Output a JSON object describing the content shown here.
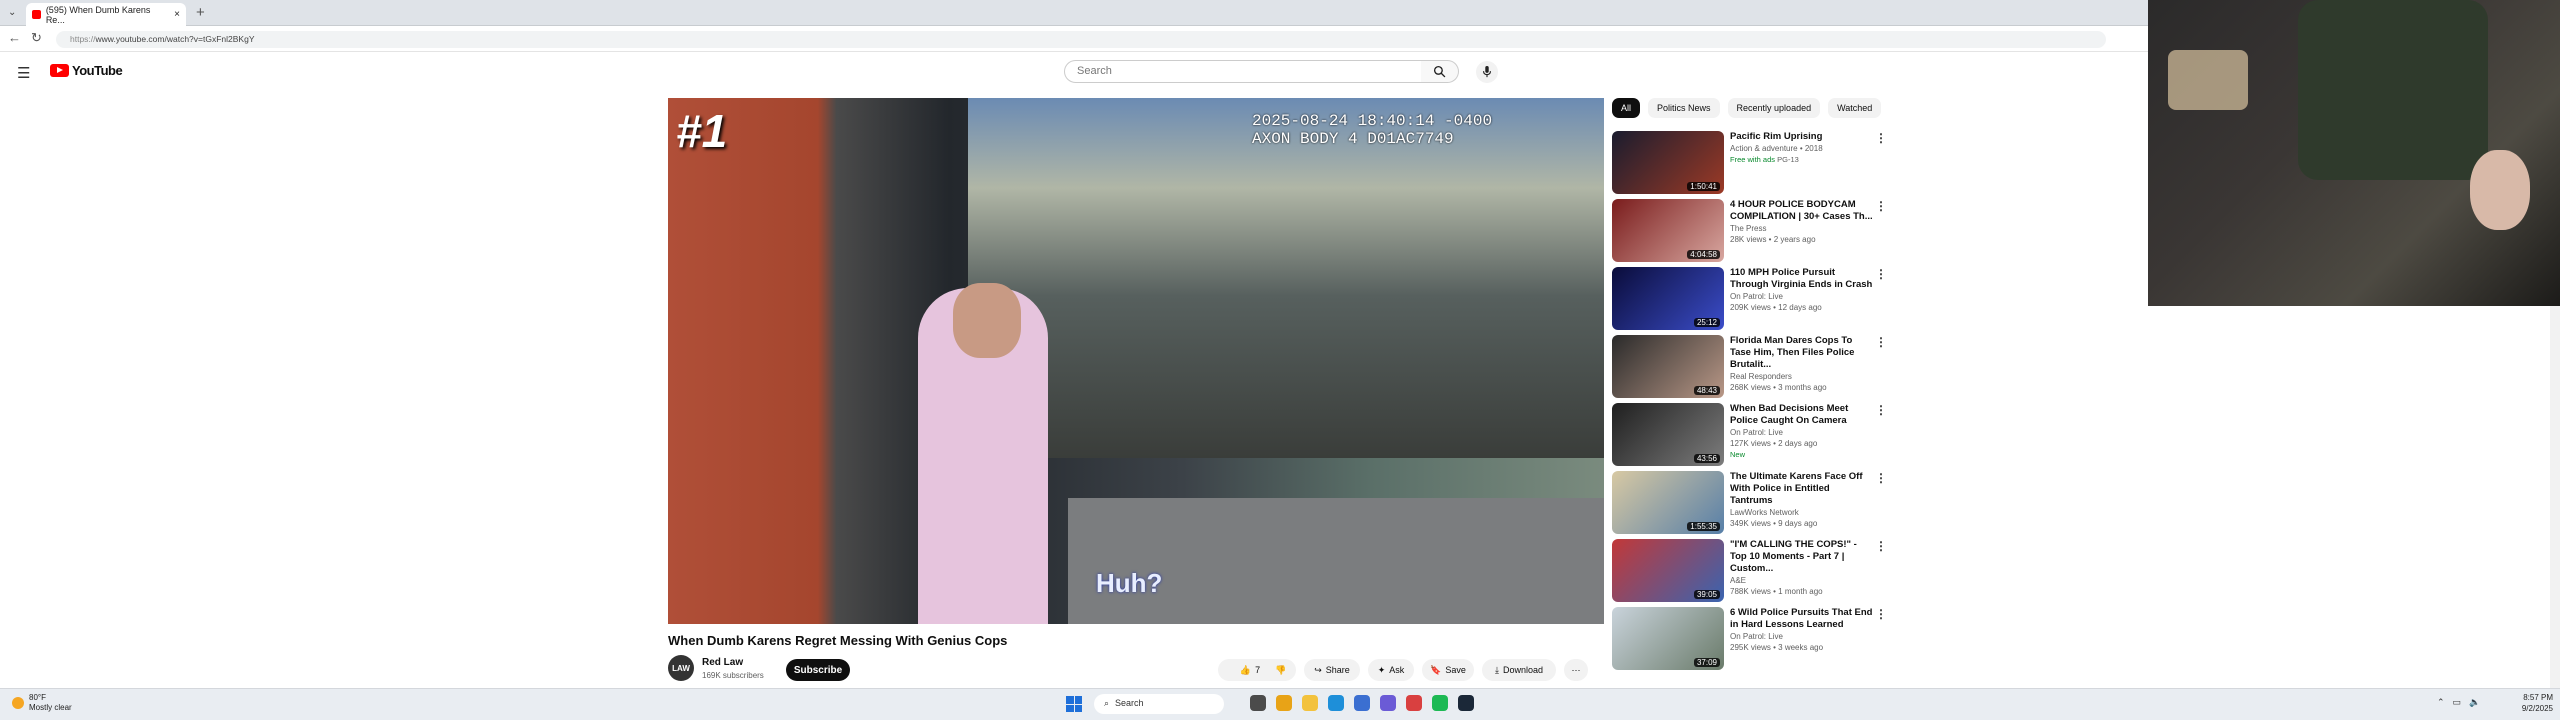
{
  "browser": {
    "tab_title": "(595) When Dumb Karens Re...",
    "url_prefix": "https://",
    "url_rest": "www.youtube.com/watch?v=tGxFnl2BKgY",
    "nav_back": "←",
    "nav_forward": "→",
    "nav_reload": "↻",
    "new_tab": "+",
    "close_tab": "×",
    "tab_menu": "⌄"
  },
  "header": {
    "menu_icon": "☰",
    "logo_text": "YouTube",
    "search_placeholder": "Search"
  },
  "video": {
    "title": "When Dumb Karens Regret Messing With Genius Cops",
    "overlay_rank": "#1",
    "overlay_timestamp_line1": "2025-08-24 18:40:14 -0400",
    "overlay_timestamp_line2": "AXON BODY 4 D01AC7749",
    "overlay_caption": "Huh?",
    "channel_name": "Red Law",
    "channel_avatar_text": "LAW",
    "channel_subs": "169K subscribers",
    "subscribe": "Subscribe",
    "actions": {
      "like_count": "7",
      "share": "Share",
      "ask": "Ask",
      "save": "Save",
      "download": "Download",
      "more": "⋯"
    }
  },
  "chips": [
    "All",
    "Politics News",
    "Recently uploaded",
    "Watched"
  ],
  "recommendations": [
    {
      "title": "Pacific Rim Uprising",
      "channel": "Action & adventure • 2018",
      "views": "",
      "badge_free": "Free with ads",
      "badge_rating": "PG-13",
      "duration": "1:50:41",
      "color_a": "#1a1c2e",
      "color_b": "#9c3a26"
    },
    {
      "title": "4 HOUR POLICE BODYCAM COMPILATION | 30+ Cases Th...",
      "channel": "The Press",
      "views": "28K views • 2 years ago",
      "badge_free": "",
      "badge_rating": "",
      "duration": "4:04:58",
      "color_a": "#7a1c1c",
      "color_b": "#d8a7a0"
    },
    {
      "title": "110 MPH Police Pursuit Through Virginia Ends in Crash",
      "channel": "On Patrol: Live",
      "views": "209K views • 12 days ago",
      "badge_free": "",
      "badge_rating": "",
      "duration": "25:12",
      "color_a": "#0a0c3a",
      "color_b": "#3b4dc9"
    },
    {
      "title": "Florida Man Dares Cops To Tase Him, Then Files Police Brutalit...",
      "channel": "Real Responders",
      "views": "268K views • 3 months ago",
      "badge_free": "",
      "badge_rating": "",
      "duration": "48:43",
      "color_a": "#2a2a2a",
      "color_b": "#b99887"
    },
    {
      "title": "When Bad Decisions Meet Police Caught On Camera",
      "channel": "On Patrol: Live",
      "views": "127K views • 2 days ago",
      "badge_free": "New",
      "badge_rating": "",
      "duration": "43:56",
      "color_a": "#1f1f1f",
      "color_b": "#7d7d7d"
    },
    {
      "title": "The Ultimate Karens Face Off With Police in Entitled Tantrums",
      "channel": "LawWorks Network",
      "views": "349K views • 9 days ago",
      "badge_free": "",
      "badge_rating": "",
      "duration": "1:55:35",
      "color_a": "#d8c9a3",
      "color_b": "#577fa8"
    },
    {
      "title": "\"I'M CALLING THE COPS!\" - Top 10 Moments - Part 7 | Custom...",
      "channel": "A&E",
      "views": "788K views • 1 month ago",
      "badge_free": "",
      "badge_rating": "",
      "duration": "39:05",
      "color_a": "#c23838",
      "color_b": "#3a64b0"
    },
    {
      "title": "6 Wild Police Pursuits That End in Hard Lessons Learned",
      "channel": "On Patrol: Live",
      "views": "295K views • 3 weeks ago",
      "badge_free": "",
      "badge_rating": "",
      "duration": "37:09",
      "color_a": "#c9d3db",
      "color_b": "#6a7b6a"
    }
  ],
  "taskbar": {
    "weather_temp": "80°F",
    "weather_desc": "Mostly clear",
    "search": "Search",
    "time": "8:57 PM",
    "date": "9/2/2025"
  }
}
